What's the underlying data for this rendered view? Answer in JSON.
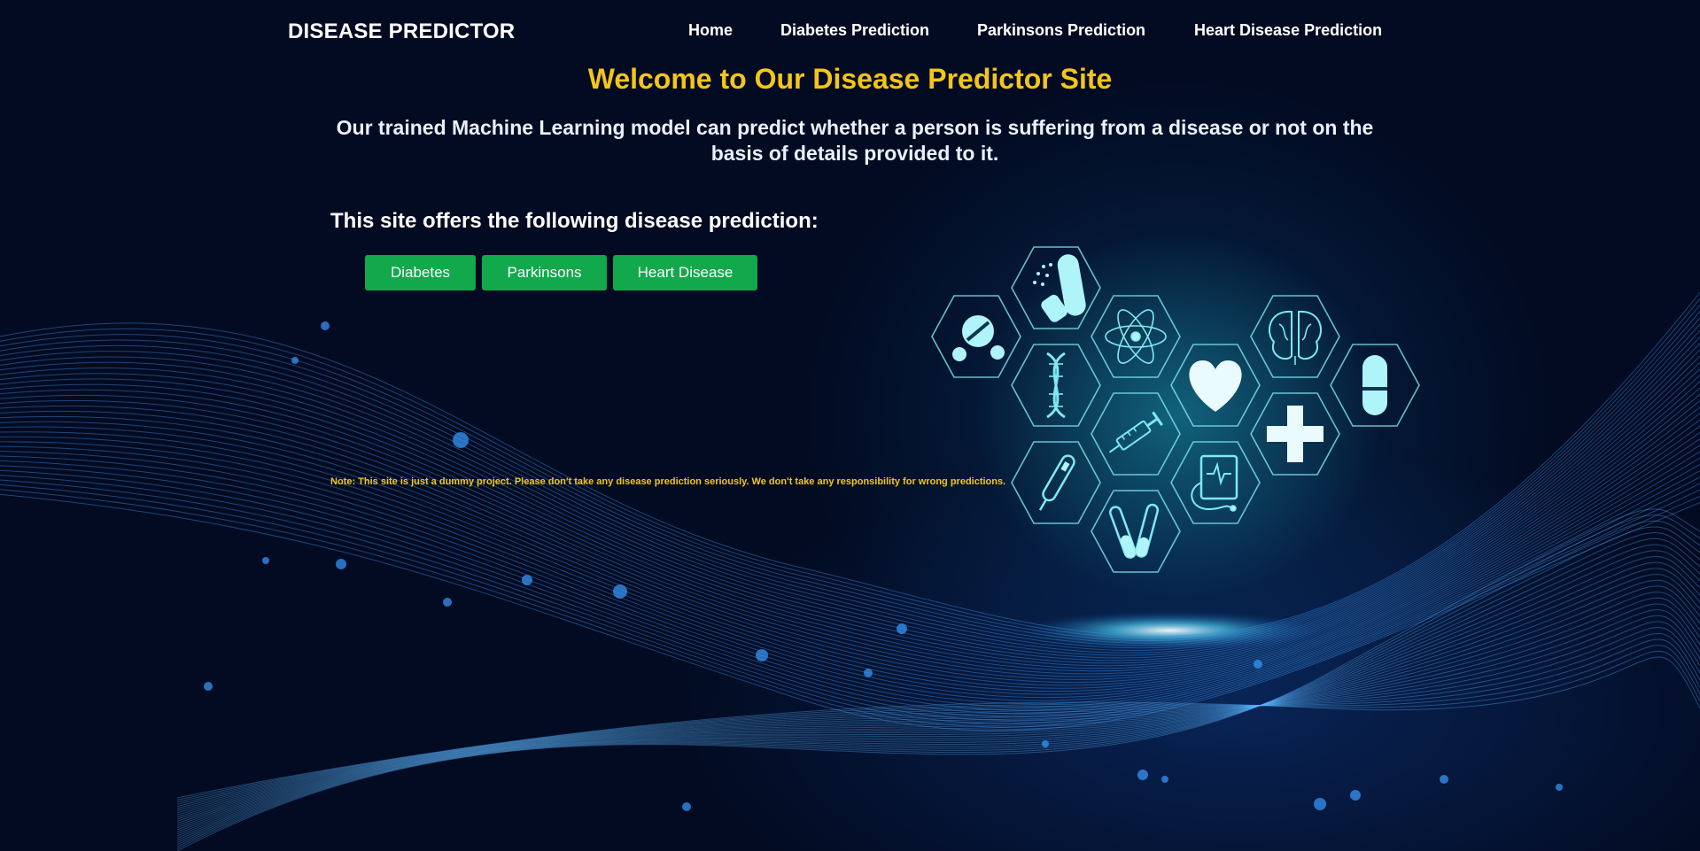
{
  "navbar": {
    "brand": "DISEASE PREDICTOR",
    "links": [
      {
        "label": "Home"
      },
      {
        "label": "Diabetes Prediction"
      },
      {
        "label": "Parkinsons Prediction"
      },
      {
        "label": "Heart Disease Prediction"
      }
    ]
  },
  "hero": {
    "title": "Welcome to Our Disease Predictor Site",
    "description": "Our trained Machine Learning model can predict whether a person is suffering from a disease or not on the basis of details provided to it."
  },
  "offers": {
    "heading": "This site offers the following disease prediction:",
    "buttons": [
      {
        "label": "Diabetes"
      },
      {
        "label": "Parkinsons"
      },
      {
        "label": "Heart Disease"
      }
    ]
  },
  "note": "Note: This site is just a dummy project. Please don't take any disease prediction seriously. We don't take any responsibility for wrong predictions.",
  "colors": {
    "background": "#020b22",
    "accent_yellow": "#f5c518",
    "button_green": "#12a84c",
    "icon_cyan": "#7fe9f0"
  },
  "icons": [
    "pills-icon",
    "capsule-spill-icon",
    "atom-icon",
    "brain-icon",
    "dna-icon",
    "heart-icon",
    "capsule-icon",
    "syringe-icon",
    "medical-cross-icon",
    "thermometer-icon",
    "ecg-monitor-icon",
    "test-tubes-icon"
  ]
}
